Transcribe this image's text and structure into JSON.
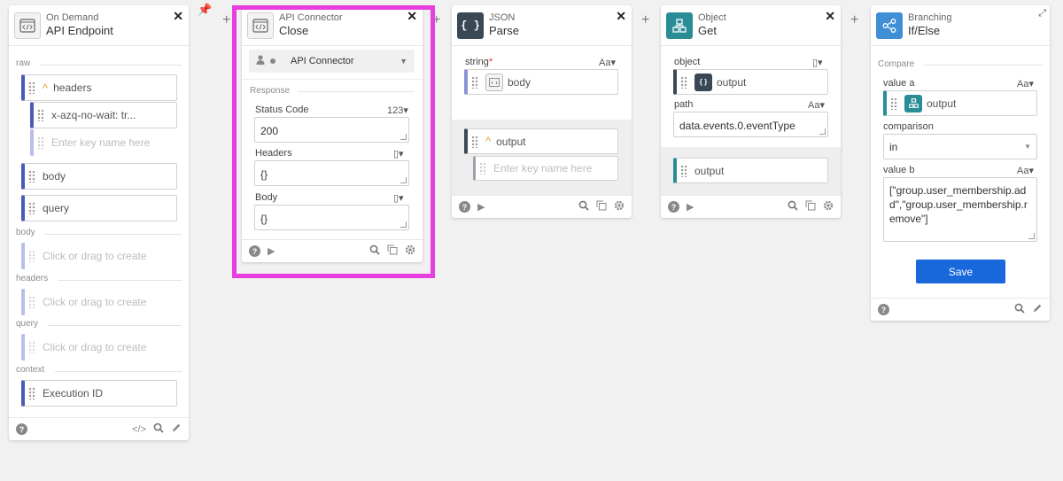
{
  "cards": {
    "ondemand": {
      "app": "On Demand",
      "op": "API Endpoint",
      "sections": {
        "raw": "raw",
        "body": "body",
        "headers": "headers",
        "query": "query",
        "context": "context"
      },
      "raw_items": {
        "headers": "headers",
        "header_value": "x-azq-no-wait: tr...",
        "key_placeholder": "Enter key name here",
        "body": "body",
        "query": "query"
      },
      "create_placeholder": "Click or drag to create",
      "execution_id": "Execution ID"
    },
    "apiconnector": {
      "app": "API Connector",
      "op": "Close",
      "account": "API Connector",
      "section": "Response",
      "status_label": "Status Code",
      "status_type": "123▾",
      "status_value": "200",
      "headers_label": "Headers",
      "headers_value": "{}",
      "body_label": "Body",
      "body_value": "{}"
    },
    "json": {
      "app": "JSON",
      "op": "Parse",
      "string_label": "string",
      "required_mark": "*",
      "string_type": "Aa▾",
      "string_value": "body",
      "output": "output",
      "key_placeholder": "Enter key name here"
    },
    "object": {
      "app": "Object",
      "op": "Get",
      "object_label": "object",
      "object_value": "output",
      "path_label": "path",
      "path_type": "Aa▾",
      "path_value": "data.events.0.eventType",
      "output": "output"
    },
    "branching": {
      "app": "Branching",
      "op": "If/Else",
      "section": "Compare",
      "value_a_label": "value a",
      "value_a_type": "Aa▾",
      "value_a": "output",
      "comparison_label": "comparison",
      "comparison_value": "in",
      "value_b_label": "value b",
      "value_b_type": "Aa▾",
      "value_b": "[\"group.user_membership.add\",\"group.user_membership.remove\"]",
      "save_label": "Save"
    }
  },
  "icons": {
    "close": "✕",
    "plus": "+",
    "help": "?",
    "run": "▶",
    "search": "search",
    "copy": "copy",
    "settings": "gear",
    "edit": "pencil",
    "code": "</>"
  },
  "colors": {
    "highlight": "#e83ee0",
    "save_button": "#1868db",
    "teal": "#2a8c94",
    "branching": "#3f8ed6"
  }
}
